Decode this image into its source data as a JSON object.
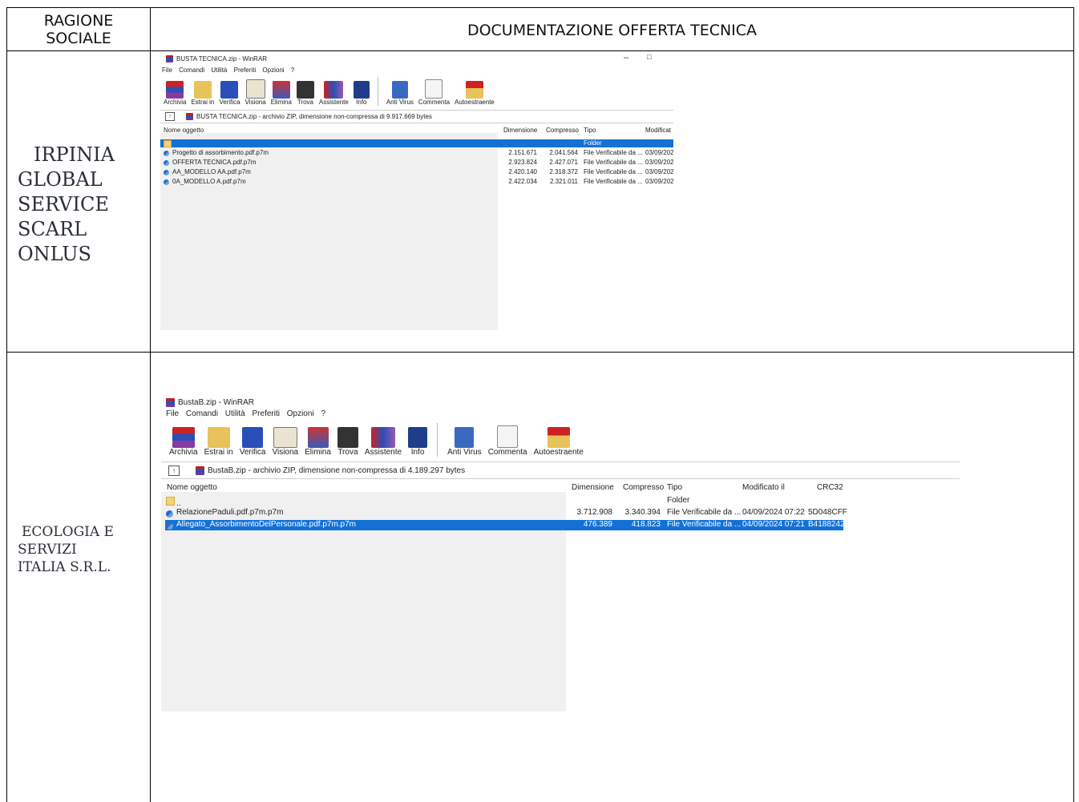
{
  "table": {
    "header_col1": [
      "RAGIONE",
      "SOCIALE"
    ],
    "header_col2": "DOCUMENTAZIONE OFFERTA TECNICA"
  },
  "row1": {
    "company": [
      "IRPINIA",
      "GLOBAL",
      "SERVICE",
      "SCARL",
      "ONLUS"
    ],
    "window": {
      "title": "BUSTA TECNICA.zip - WinRAR",
      "menu": [
        "File",
        "Comandi",
        "Utilità",
        "Preferiti",
        "Opzioni",
        "?"
      ],
      "toolbar": [
        "Archivia",
        "Estrai in",
        "Verifica",
        "Visiona",
        "Elimina",
        "Trova",
        "Assistente",
        "Info",
        "Anti Virus",
        "Commenta",
        "Autoestraente"
      ],
      "address": "BUSTA TECNICA.zip - archivio ZIP, dimensione non-compressa di 9.917.669 bytes",
      "columns": [
        "Nome oggetto",
        "Dimensione",
        "Compresso",
        "Tipo",
        "Modificat"
      ],
      "rows": [
        {
          "name": "..",
          "size": "",
          "packed": "",
          "type": "Folder",
          "modified": "",
          "selected": true
        },
        {
          "name": "Progetto di assorbimento.pdf.p7m",
          "size": "2.151.671",
          "packed": "2.041.564",
          "type": "File Verificabile da ...",
          "modified": "03/09/202"
        },
        {
          "name": "OFFERTA TECNICA.pdf.p7m",
          "size": "2.923.824",
          "packed": "2.427.071",
          "type": "File Verificabile da ...",
          "modified": "03/09/202"
        },
        {
          "name": "AA_MODELLO AA.pdf.p7m",
          "size": "2.420.140",
          "packed": "2.318.372",
          "type": "File Verificabile da ...",
          "modified": "03/09/202"
        },
        {
          "name": "0A_MODELLO A.pdf.p7m",
          "size": "2.422.034",
          "packed": "2.321.011",
          "type": "File Verificabile da ...",
          "modified": "03/09/202"
        }
      ]
    }
  },
  "row2": {
    "company": [
      "ECOLOGIA E",
      "SERVIZI",
      "ITALIA  S.R.L."
    ],
    "window": {
      "title": "BustaB.zip - WinRAR",
      "menu": [
        "File",
        "Comandi",
        "Utilità",
        "Preferiti",
        "Opzioni",
        "?"
      ],
      "toolbar": [
        "Archivia",
        "Estrai in",
        "Verifica",
        "Visiona",
        "Elimina",
        "Trova",
        "Assistente",
        "Info",
        "Anti Virus",
        "Commenta",
        "Autoestraente"
      ],
      "address": "BustaB.zip - archivio ZIP, dimensione non-compressa di 4.189.297 bytes",
      "columns": [
        "Nome oggetto",
        "Dimensione",
        "Compresso",
        "Tipo",
        "Modificato il",
        "CRC32"
      ],
      "rows": [
        {
          "name": "..",
          "size": "",
          "packed": "",
          "type": "Folder",
          "modified": "",
          "crc": ""
        },
        {
          "name": "RelazionePaduli.pdf.p7m.p7m",
          "size": "3.712.908",
          "packed": "3.340.394",
          "type": "File Verificabile da ...",
          "modified": "04/09/2024 07:22",
          "crc": "5D048CFF"
        },
        {
          "name": "Allegato_AssorbimentoDelPersonale.pdf.p7m.p7m",
          "size": "476.389",
          "packed": "418.823",
          "type": "File Verificabile da ...",
          "modified": "04/09/2024 07:21",
          "crc": "B4188242",
          "selected": true
        }
      ]
    }
  },
  "colors": {
    "selection": "#1371d6",
    "text": "#222222"
  }
}
